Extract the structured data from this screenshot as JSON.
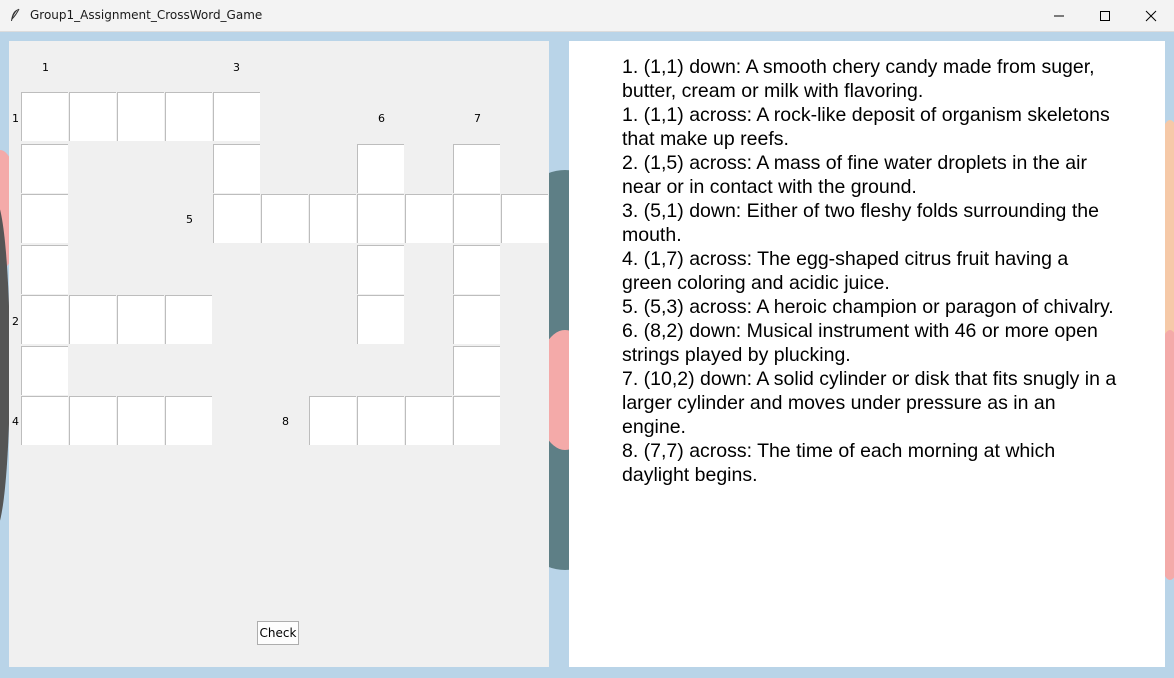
{
  "window": {
    "title": "Group1_Assignment_CrossWord_Game",
    "icon": "feather-icon",
    "controls": [
      "minimize-icon",
      "maximize-icon",
      "close-icon"
    ]
  },
  "colors": {
    "background": "#b9d4e8",
    "panel": "#f0f0f0",
    "cell": "#ffffff",
    "clue_panel": "#ffffff"
  },
  "crossword": {
    "labels": {
      "col1": "1",
      "col3": "3",
      "row1": "1",
      "col6": "6",
      "col7": "7",
      "row5": "5",
      "row2": "2",
      "row4": "4",
      "col8": "8"
    },
    "check_label": "Check"
  },
  "clues": [
    "1. (1,1) down: A smooth chery candy made from suger, butter, cream or milk with flavoring.",
    "1. (1,1) across: A rock-like deposit of organism skeletons that make up reefs.",
    "2. (1,5) across: A mass of fine water droplets in the air near or in contact with the ground.",
    "3. (5,1) down: Either of two fleshy folds surrounding the mouth.",
    "4. (1,7) across: The egg-shaped citrus fruit having a green coloring and acidic juice.",
    "5. (5,3) across: A heroic champion or paragon of chivalry.",
    "6. (8,2) down: Musical instrument with 46 or more open strings played by plucking.",
    "7. (10,2) down: A solid cylinder or disk that fits snugly in a larger cylinder and moves under pressure as in an engine.",
    "8. (7,7) across: The time of each morning at which daylight begins."
  ]
}
